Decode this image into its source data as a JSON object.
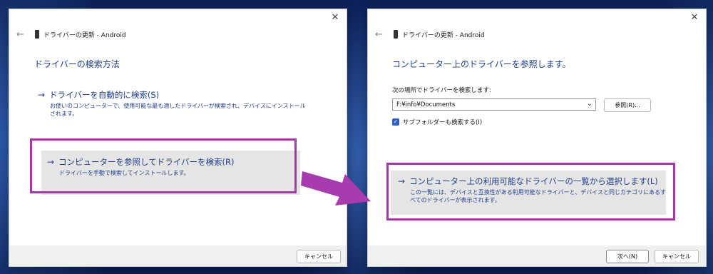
{
  "left": {
    "title": "ドライバーの更新 - Android",
    "heading": "ドライバーの検索方法",
    "option1": {
      "title": "ドライバーを自動的に検索(S)",
      "desc": "お使いのコンピューターで、使用可能な最も適したドライバーが検索され、デバイスにインストールされます。"
    },
    "option2": {
      "title": "コンピューターを参照してドライバーを検索(R)",
      "desc": "ドライバーを手動で検索してインストールします。"
    },
    "cancel": "キャンセル"
  },
  "right": {
    "title": "ドライバーの更新 - Android",
    "heading": "コンピューター上のドライバーを参照します。",
    "search_label": "次の場所でドライバーを検索します:",
    "path_value": "F:¥info¥Documents",
    "browse": "参照(R)...",
    "subfolders": "サブフォルダーも検索する(I)",
    "option": {
      "title": "コンピューター上の利用可能なドライバーの一覧から選択します(L)",
      "desc": "この一覧には、デバイスと互換性がある利用可能なドライバーと、デバイスと同じカテゴリにあるすべてのドライバーが表示されます。"
    },
    "next": "次へ(N)",
    "cancel": "キャンセル"
  },
  "colors": {
    "highlight": "#a23aa6",
    "link_text": "#1f3e8a",
    "arrow": "#a83bb0"
  }
}
